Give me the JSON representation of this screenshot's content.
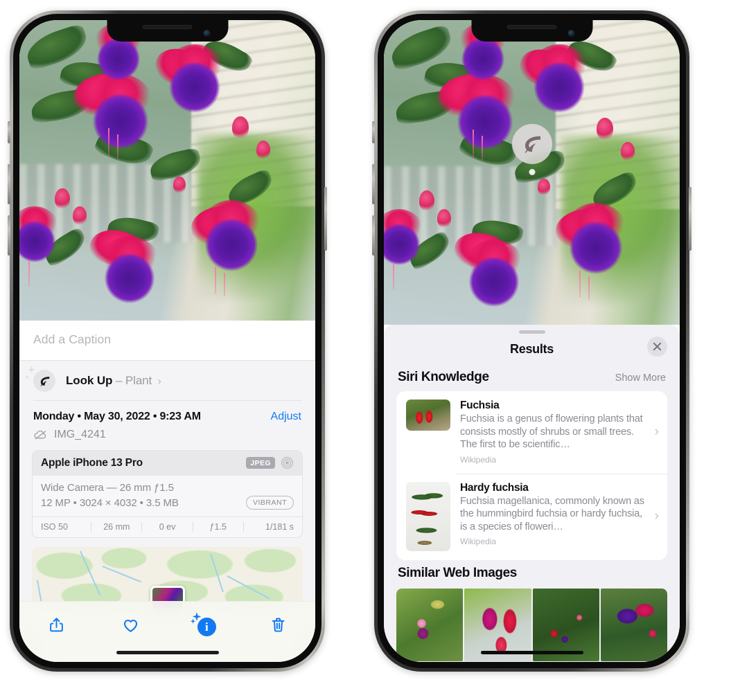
{
  "left_phone": {
    "photo": {
      "alt": "fuchsia-flowers-photo"
    },
    "caption_field": {
      "placeholder": "Add a Caption",
      "value": ""
    },
    "look_up": {
      "label": "Look Up",
      "separator": "–",
      "subject": "Plant",
      "chevron": "›",
      "icon": "leaf-icon"
    },
    "date_line": "Monday • May 30, 2022 • 9:23 AM",
    "adjust_label": "Adjust",
    "file_name": "IMG_4241",
    "file_icon": "cloud-slash-icon",
    "metadata": {
      "device": "Apple iPhone 13 Pro",
      "format_badge": "JPEG",
      "hdr_icon": "aperture-icon",
      "lens_line": "Wide Camera — 26 mm ƒ1.5",
      "size_line": "12 MP • 3024 × 4032 • 3.5 MB",
      "color_badge": "VIBRANT",
      "exif": [
        "ISO 50",
        "26 mm",
        "0 ev",
        "ƒ1.5",
        "1/181 s"
      ]
    },
    "toolbar": [
      {
        "name": "share-button",
        "icon": "share-icon"
      },
      {
        "name": "favorite-button",
        "icon": "heart-icon"
      },
      {
        "name": "info-button",
        "icon": "info-sparkle-icon",
        "glyph": "i"
      },
      {
        "name": "delete-button",
        "icon": "trash-icon"
      }
    ]
  },
  "right_phone": {
    "photo": {
      "alt": "fuchsia-flowers-photo"
    },
    "visual_lookup_badge": {
      "icon": "leaf-icon"
    },
    "sheet": {
      "title": "Results",
      "close_icon": "close-icon",
      "sections": [
        {
          "title": "Siri Knowledge",
          "action": "Show More",
          "items": [
            {
              "title": "Fuchsia",
              "description": "Fuchsia is a genus of flowering plants that consists mostly of shrubs or small trees. The first to be scientific…",
              "source": "Wikipedia",
              "chevron": "›",
              "thumb": "fuchsia-thumb"
            },
            {
              "title": "Hardy fuchsia",
              "description": "Fuchsia magellanica, commonly known as the hummingbird fuchsia or hardy fuchsia, is a species of floweri…",
              "source": "Wikipedia",
              "chevron": "›",
              "thumb": "hardy-fuchsia-thumb"
            }
          ]
        },
        {
          "title": "Similar Web Images",
          "images": [
            {
              "name": "similar-image-1"
            },
            {
              "name": "similar-image-2"
            },
            {
              "name": "similar-image-3"
            },
            {
              "name": "similar-image-4"
            }
          ]
        }
      ]
    }
  },
  "colors": {
    "accent_blue": "#1379f3",
    "sheet_bg": "#f1f0f5",
    "panel_bg": "#f4f4f6",
    "secondary_text": "#8b8a93"
  }
}
